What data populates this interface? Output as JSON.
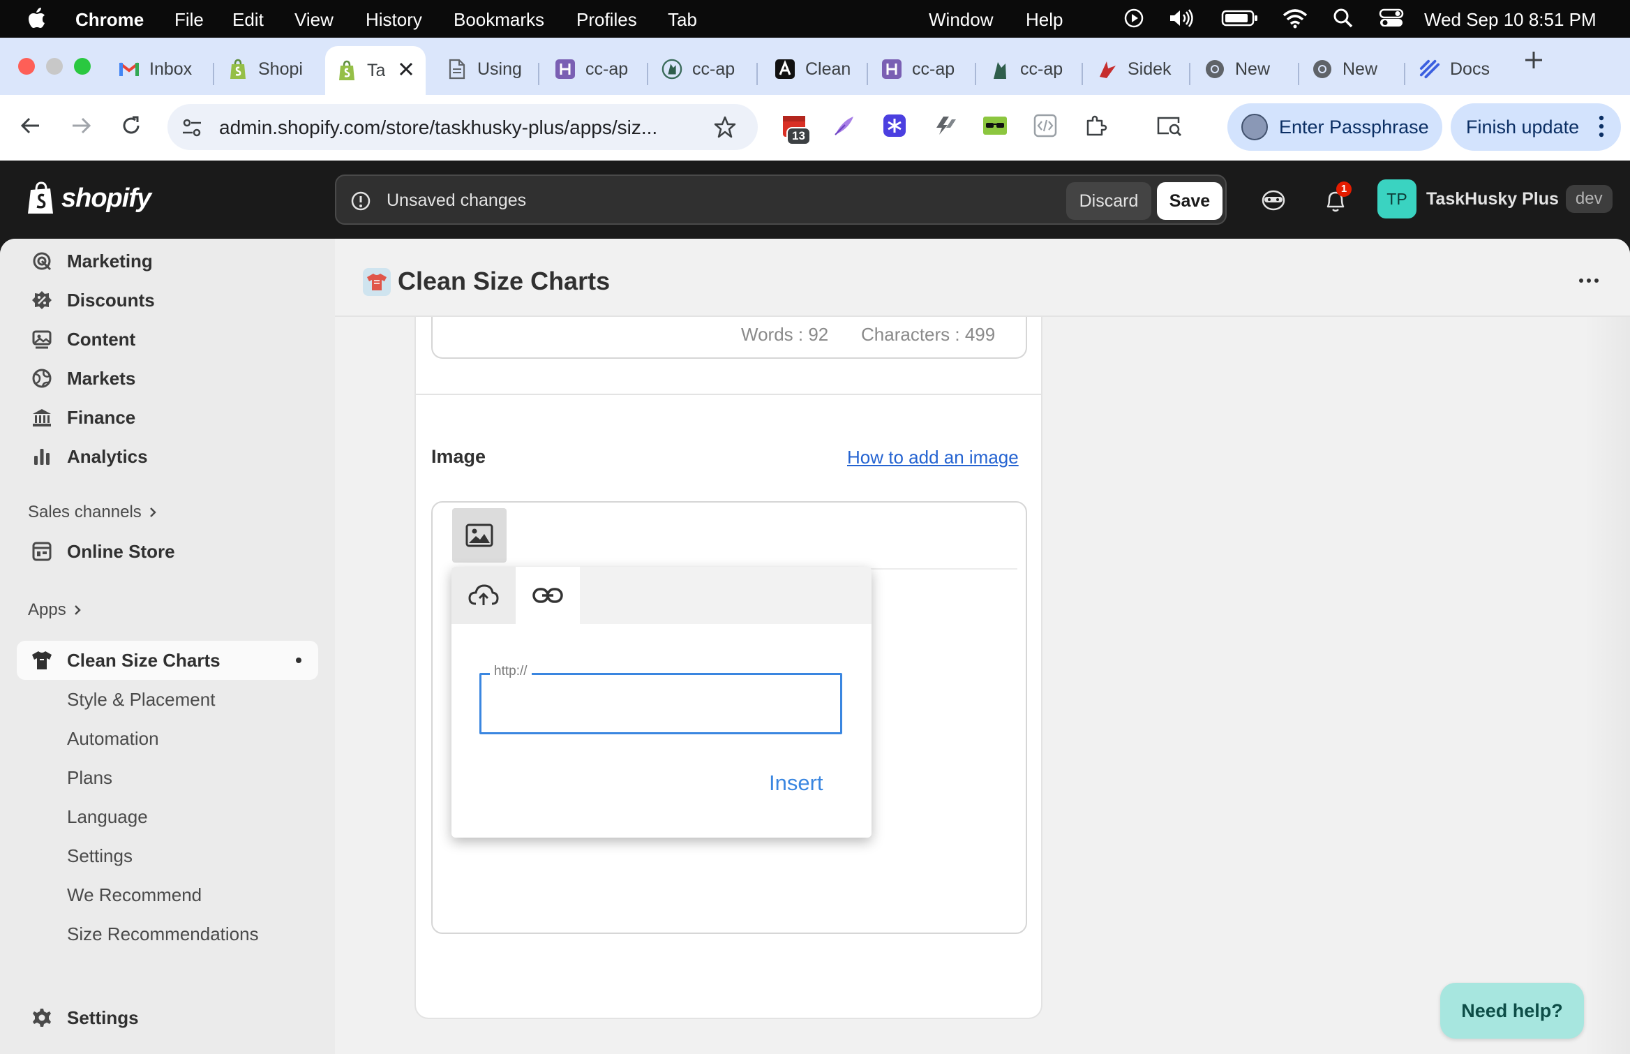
{
  "menubar": {
    "app": "Chrome",
    "items": [
      "File",
      "Edit",
      "View",
      "History",
      "Bookmarks",
      "Profiles",
      "Tab"
    ],
    "right_items": [
      "Window",
      "Help"
    ],
    "clock": "Wed Sep 10  8:51 PM"
  },
  "tabs": [
    {
      "title": "Inbox",
      "icon": "gmail-icon"
    },
    {
      "title": "Shopi",
      "icon": "shopify-bag-icon"
    },
    {
      "title": "Ta",
      "icon": "shopify-bag-icon",
      "active": true
    },
    {
      "title": "Using",
      "icon": "document-icon"
    },
    {
      "title": "cc-ap",
      "icon": "h-app-icon"
    },
    {
      "title": "cc-ap",
      "icon": "husky-icon"
    },
    {
      "title": "Clean",
      "icon": "clean-app-icon"
    },
    {
      "title": "cc-ap",
      "icon": "h-app-icon"
    },
    {
      "title": "cc-ap",
      "icon": "husky-icon"
    },
    {
      "title": "Sidek",
      "icon": "sidekick-icon"
    },
    {
      "title": "New",
      "icon": "chrome-icon"
    },
    {
      "title": "New",
      "icon": "chrome-icon"
    },
    {
      "title": "Docs",
      "icon": "docs-icon"
    }
  ],
  "toolbar": {
    "url": "admin.shopify.com/store/taskhusky-plus/apps/siz...",
    "ext_badge": "13",
    "passphrase_label": "Enter Passphrase",
    "update_label": "Finish update"
  },
  "shopify": {
    "logo_text": "shopify",
    "unsaved_text": "Unsaved changes",
    "discard_label": "Discard",
    "save_label": "Save",
    "notif_count": "1",
    "store_initials": "TP",
    "store_name": "TaskHusky Plus",
    "store_tag": "dev"
  },
  "sidebar": {
    "items": [
      {
        "label": "Marketing",
        "icon": "marketing-icon"
      },
      {
        "label": "Discounts",
        "icon": "discounts-icon"
      },
      {
        "label": "Content",
        "icon": "content-icon"
      },
      {
        "label": "Markets",
        "icon": "markets-icon"
      },
      {
        "label": "Finance",
        "icon": "finance-icon"
      },
      {
        "label": "Analytics",
        "icon": "analytics-icon"
      }
    ],
    "sales_channels_label": "Sales channels",
    "online_store_label": "Online Store",
    "apps_label": "Apps",
    "app_name": "Clean Size Charts",
    "app_sub_items": [
      "Style & Placement",
      "Automation",
      "Plans",
      "Language",
      "Settings",
      "We Recommend",
      "Size Recommendations"
    ],
    "settings_label": "Settings"
  },
  "main": {
    "title": "Clean Size Charts",
    "words": "Words : 92",
    "characters": "Characters : 499",
    "image_label": "Image",
    "image_help_link": "How to add an image",
    "url_placeholder": "http://",
    "url_value": "",
    "insert_label": "Insert",
    "need_help_label": "Need help?"
  }
}
